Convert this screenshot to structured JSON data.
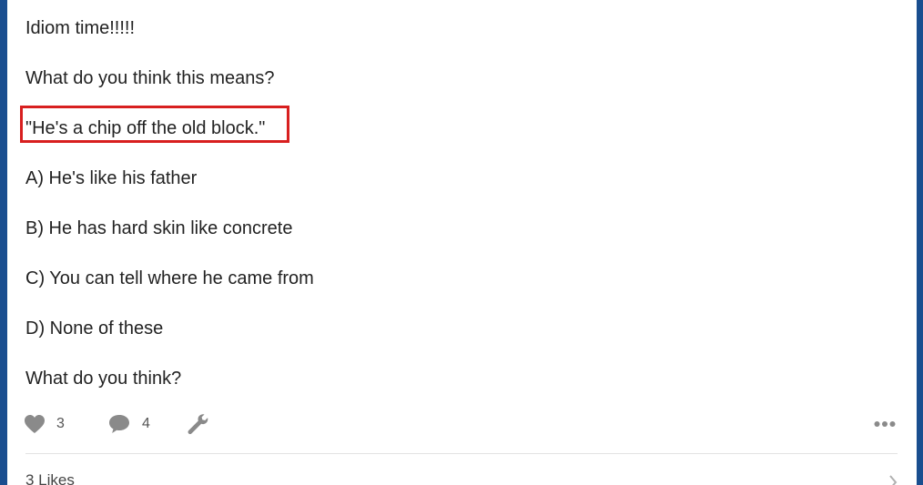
{
  "post": {
    "lines": [
      "Idiom time!!!!!",
      "What do you think this means?",
      "\"He's a chip off the old block.\"",
      "A) He's like his father",
      "B) He has hard skin like concrete",
      "C) You can tell where he came from",
      "D) None of these",
      "What do you think?"
    ]
  },
  "actions": {
    "likes_count": "3",
    "comments_count": "4"
  },
  "footer": {
    "likes_label": "3 Likes"
  },
  "colors": {
    "background_border": "#1a4e8f",
    "highlight": "#d81f1f",
    "icon_gray": "#888888"
  },
  "icons": {
    "like": "heart-icon",
    "comment": "speech-bubble-icon",
    "tools": "wrench-icon",
    "more": "more-dots-icon",
    "chevron": "chevron-right-icon"
  }
}
